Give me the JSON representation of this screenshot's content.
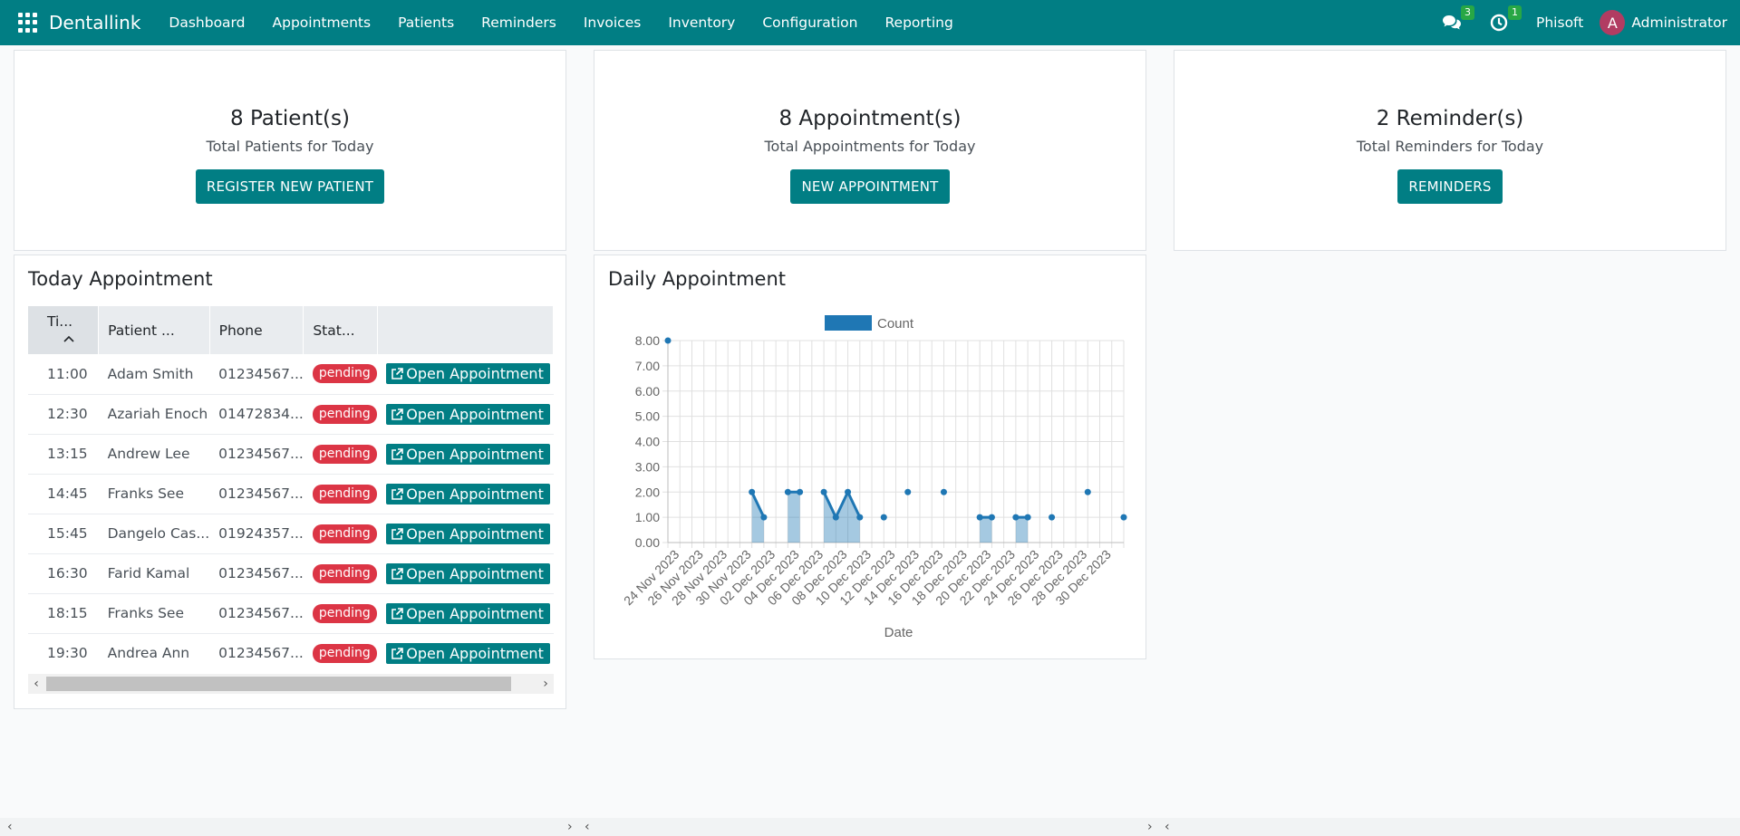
{
  "navbar": {
    "brand": "Dentallink",
    "menu": [
      "Dashboard",
      "Appointments",
      "Patients",
      "Reminders",
      "Invoices",
      "Inventory",
      "Configuration",
      "Reporting"
    ],
    "messages_count": "3",
    "activities_count": "1",
    "company": "Phisoft",
    "user_initial": "A",
    "user_name": "Administrator"
  },
  "stats": {
    "patients": {
      "number": "8 Patient(s)",
      "label": "Total Patients for Today",
      "button": "REGISTER NEW PATIENT"
    },
    "appointments": {
      "number": "8 Appointment(s)",
      "label": "Total Appointments for Today",
      "button": "NEW APPOINTMENT"
    },
    "reminders": {
      "number": "2 Reminder(s)",
      "label": "Total Reminders for Today",
      "button": "REMINDERS"
    }
  },
  "today": {
    "title": "Today Appointment",
    "columns": [
      "Ti...",
      "Patient ...",
      "Phone",
      "Stat..."
    ],
    "action_label": "Open Appointment",
    "rows": [
      {
        "time": "11:00",
        "patient": "Adam Smith",
        "phone": "01234567...",
        "status": "pending"
      },
      {
        "time": "12:30",
        "patient": "Azariah Enoch",
        "phone": "01472834...",
        "status": "pending"
      },
      {
        "time": "13:15",
        "patient": "Andrew Lee",
        "phone": "01234567...",
        "status": "pending"
      },
      {
        "time": "14:45",
        "patient": "Franks See",
        "phone": "01234567...",
        "status": "pending"
      },
      {
        "time": "15:45",
        "patient": "Dangelo Cas...",
        "phone": "01924357...",
        "status": "pending"
      },
      {
        "time": "16:30",
        "patient": "Farid Kamal",
        "phone": "01234567...",
        "status": "pending"
      },
      {
        "time": "18:15",
        "patient": "Franks See",
        "phone": "01234567...",
        "status": "pending"
      },
      {
        "time": "19:30",
        "patient": "Andrea Ann",
        "phone": "01234567...",
        "status": "pending"
      }
    ]
  },
  "daily": {
    "title": "Daily Appointment"
  },
  "chart_data": {
    "type": "area",
    "title": "",
    "xlabel": "Date",
    "ylabel": "",
    "legend": [
      "Count"
    ],
    "legend_position": "top",
    "grid": true,
    "ylim": [
      0,
      8
    ],
    "yticks": [
      "0.00",
      "1.00",
      "2.00",
      "3.00",
      "4.00",
      "5.00",
      "6.00",
      "7.00",
      "8.00"
    ],
    "xticks": [
      "24 Nov 2023",
      "26 Nov 2023",
      "28 Nov 2023",
      "30 Nov 2023",
      "02 Dec 2023",
      "04 Dec 2023",
      "06 Dec 2023",
      "08 Dec 2023",
      "10 Dec 2023",
      "12 Dec 2023",
      "14 Dec 2023",
      "16 Dec 2023",
      "18 Dec 2023",
      "20 Dec 2023",
      "22 Dec 2023",
      "24 Dec 2023",
      "26 Dec 2023",
      "28 Dec 2023",
      "30 Dec 2023"
    ],
    "series": [
      {
        "name": "Count",
        "color": "#1f77b4",
        "points": [
          [
            "2023-11-23",
            8
          ],
          [
            "2023-11-30",
            2
          ],
          [
            "2023-12-01",
            1
          ],
          [
            "2023-12-03",
            2
          ],
          [
            "2023-12-04",
            2
          ],
          [
            "2023-12-06",
            2
          ],
          [
            "2023-12-07",
            1
          ],
          [
            "2023-12-08",
            2
          ],
          [
            "2023-12-09",
            1
          ],
          [
            "2023-12-11",
            1
          ],
          [
            "2023-12-13",
            2
          ],
          [
            "2023-12-16",
            2
          ],
          [
            "2023-12-19",
            1
          ],
          [
            "2023-12-20",
            1
          ],
          [
            "2023-12-22",
            1
          ],
          [
            "2023-12-23",
            1
          ],
          [
            "2023-12-25",
            1
          ],
          [
            "2023-12-28",
            2
          ],
          [
            "2023-12-31",
            1
          ]
        ]
      }
    ]
  },
  "colors": {
    "brand": "#017e84",
    "danger": "#dc3545",
    "series": "#1f77b4"
  }
}
